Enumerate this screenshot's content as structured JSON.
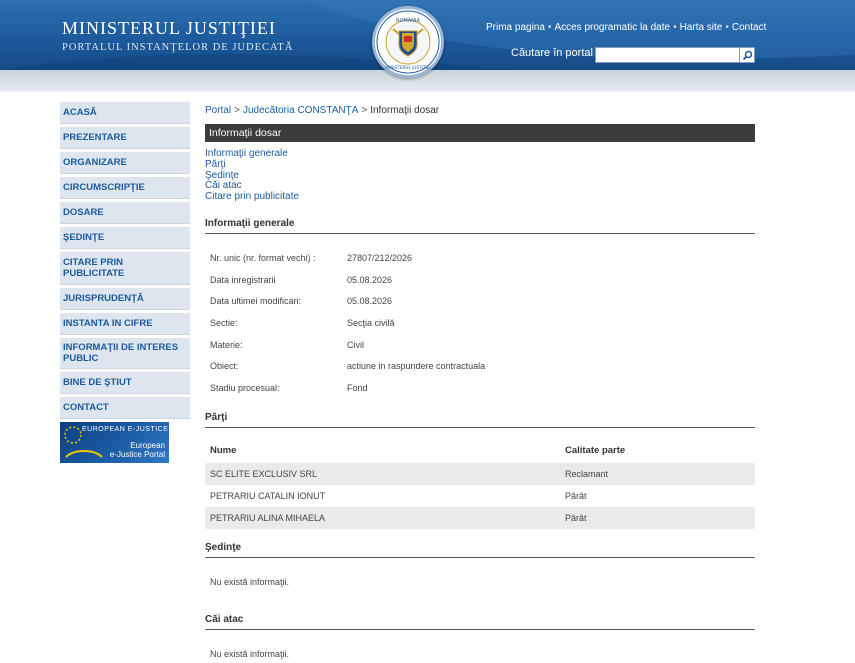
{
  "header": {
    "title": "MINISTERUL JUSTIŢIEI",
    "subtitle": "PORTALUL INSTANŢELOR DE JUDECATĂ",
    "emblem_top_text": "ROMANIA",
    "emblem_bottom_text": "MINISTERUL JUSTIŢIEI",
    "links": [
      "Prima pagina",
      "Acces programatic la date",
      "Harta site",
      "Contact"
    ],
    "search_label": "Căutare în portal",
    "search_value": "",
    "colors": {
      "header_blue": "#1c5a9c",
      "link_blue": "#1c5a9c",
      "dark_bar": "#3b3b3b"
    }
  },
  "sidebar": {
    "items": [
      "ACASĂ",
      "PREZENTARE",
      "ORGANIZARE",
      "CIRCUMSCRIPŢIE",
      "DOSARE",
      "ŞEDINŢE",
      "CITARE PRIN PUBLICITATE",
      "JURISPRUDENŢĂ",
      "INSTANTA IN CIFRE",
      "INFORMAŢII DE INTERES PUBLIC",
      "BINE DE ŞTIUT",
      "CONTACT"
    ],
    "ejustice_top": "EUROPEAN E-JUSTICE",
    "ejustice_line1": "European",
    "ejustice_line2": "e-Justice Portal"
  },
  "breadcrumb": {
    "portal": "Portal",
    "court": "Judecătoria CONSTANŢA",
    "current": "Informaţii dosar",
    "sep": ">"
  },
  "page": {
    "bar_title": "Informaţii dosar",
    "toc": [
      "Informaţii generale",
      "Părţi",
      "Şedinţe",
      "Căi atac",
      "Citare prin publicitate"
    ]
  },
  "general": {
    "heading": "Informaţii generale",
    "rows": [
      {
        "label": "Nr. unic (nr. format vechi) :",
        "value": "27807/212/2026"
      },
      {
        "label": "Data inregistrarii",
        "value": "05.08.2026"
      },
      {
        "label": "Data ultimei modificari:",
        "value": "05.08.2026"
      },
      {
        "label": "Sectie:",
        "value": "Secţia civilă"
      },
      {
        "label": "Materie:",
        "value": "Civil"
      },
      {
        "label": "Obiect:",
        "value": "actiune in raspundere contractuala"
      },
      {
        "label": "Stadiu procesual:",
        "value": "Fond"
      }
    ]
  },
  "parties": {
    "heading": "Părţi",
    "col_name": "Nume",
    "col_role": "Calitate parte",
    "rows": [
      {
        "name": "SC ELITE EXCLUSIV SRL",
        "role": "Reclamant"
      },
      {
        "name": "PETRARIU CATALIN IONUT",
        "role": "Pârât"
      },
      {
        "name": "PETRARIU ALINA MIHAELA",
        "role": "Pârât"
      }
    ]
  },
  "sessions": {
    "heading": "Şedinţe",
    "empty": "Nu există informaţii."
  },
  "appeals": {
    "heading": "Căi atac",
    "empty": "Nu există informaţii."
  }
}
